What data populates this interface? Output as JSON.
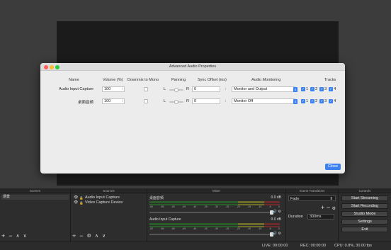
{
  "dialog": {
    "title": "Advanced Audio Properties",
    "headers": {
      "name": "Name",
      "volume": "Volume (%)",
      "downmix": "Downmix to Mono",
      "panning": "Panning",
      "sync": "Sync Offset (ms)",
      "monitoring": "Audio Monitoring",
      "tracks": "Tracks"
    },
    "rows": [
      {
        "name": "Audio Input Capture",
        "volume": "100",
        "pan_left": "L",
        "pan_right": "R",
        "sync": "0",
        "monitor": "Monitor and Output"
      },
      {
        "name": "桌面音频",
        "volume": "100",
        "pan_left": "L",
        "pan_right": "R",
        "sync": "0",
        "monitor": "Monitor Off"
      }
    ],
    "tracks": [
      "1",
      "2",
      "3",
      "4"
    ],
    "close_label": "Close"
  },
  "docks": {
    "scenes": {
      "title": "Scenes",
      "items": [
        "场景"
      ]
    },
    "sources": {
      "title": "Sources",
      "items": [
        "Audio Input Capture",
        "Video Capture Device"
      ]
    },
    "mixer": {
      "title": "Mixer",
      "channels": [
        {
          "name": "桌面音频",
          "db": "0.0 dB"
        },
        {
          "name": "Audio Input Capture",
          "db": "0.0 dB"
        }
      ],
      "ticks": [
        "-60",
        "-55",
        "-50",
        "-45",
        "-40",
        "-35",
        "-30",
        "-25",
        "-20",
        "-15",
        "-10",
        "-5",
        "0"
      ]
    },
    "transitions": {
      "title": "Scene Transitions",
      "selected": "Fade",
      "duration_label": "Duration",
      "duration_value": "300ms"
    },
    "controls": {
      "title": "Controls",
      "buttons": [
        "Start Streaming",
        "Start Recording",
        "Studio Mode",
        "Settings",
        "Exit"
      ]
    }
  },
  "status": {
    "live": "LIVE: 00:00:00",
    "rec": "REC: 00:00:00",
    "cpu": "CPU: 0.8%, 30.00 fps"
  },
  "colors": {
    "accent": "#3b82f0",
    "preview": "#1b1b1b"
  }
}
